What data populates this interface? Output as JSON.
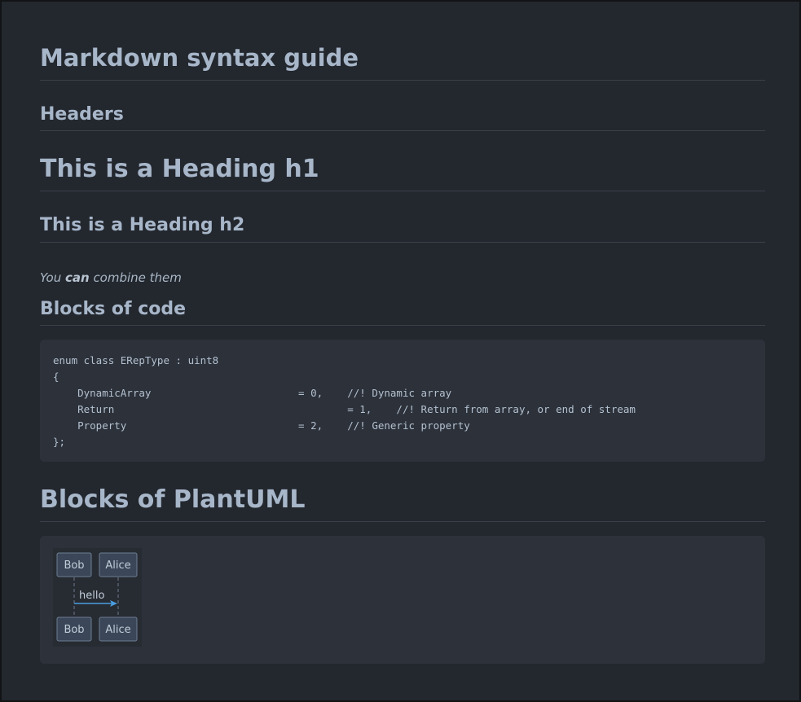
{
  "page": {
    "title": "Markdown syntax guide"
  },
  "sections": {
    "headers_title": "Headers",
    "h1_example": "This is a Heading h1",
    "h2_example": "This is a Heading h2",
    "combine": {
      "before": "You ",
      "bold": "can",
      "after": " combine them"
    },
    "code_title": "Blocks of code",
    "code_lines": [
      "enum class ERepType : uint8",
      "{",
      "    DynamicArray                        = 0,    //! Dynamic array",
      "    Return                                      = 1,    //! Return from array, or end of stream",
      "    Property                            = 2,    //! Generic property",
      "};"
    ],
    "plantuml_title": "Blocks of PlantUML"
  },
  "uml": {
    "participants": [
      "Bob",
      "Alice"
    ],
    "message": "hello",
    "colors": {
      "box_fill": "#3b4758",
      "box_stroke": "#6b7c91",
      "lifeline": "#6e7c8e",
      "arrow": "#4a9ee0",
      "text": "#c2ccd8"
    }
  }
}
